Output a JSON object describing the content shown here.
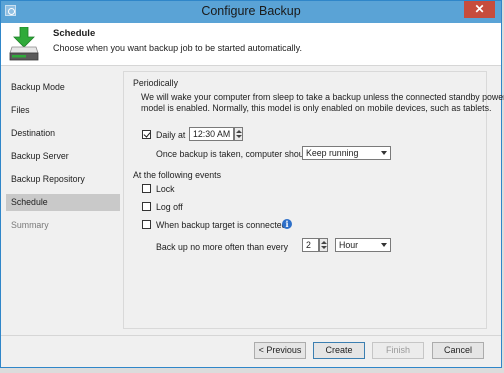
{
  "window": {
    "title": "Configure Backup",
    "close_glyph": "✕"
  },
  "header": {
    "title": "Schedule",
    "subtitle": "Choose when you want backup job to be started automatically.",
    "icon": "download-drive-icon"
  },
  "sidebar": {
    "items": [
      {
        "label": "Backup Mode",
        "state": "normal"
      },
      {
        "label": "Files",
        "state": "normal"
      },
      {
        "label": "Destination",
        "state": "normal"
      },
      {
        "label": "Backup Server",
        "state": "normal"
      },
      {
        "label": "Backup Repository",
        "state": "normal"
      },
      {
        "label": "Schedule",
        "state": "active"
      },
      {
        "label": "Summary",
        "state": "disabled"
      }
    ]
  },
  "periodically": {
    "label": "Periodically",
    "description_line1": "We will wake your computer from sleep to take a backup unless the connected standby power",
    "description_line2": "model is enabled. Normally, this model is only enabled on mobile devices, such as tablets.",
    "daily": {
      "label": "Daily at",
      "checked": true,
      "time": "12:30 AM"
    },
    "after_backup": {
      "label": "Once backup is taken, computer should",
      "value": "Keep running"
    }
  },
  "events": {
    "label": "At the following events",
    "lock": {
      "label": "Lock",
      "checked": false
    },
    "logoff": {
      "label": "Log off",
      "checked": false
    },
    "target_connected": {
      "label": "When backup target is connected",
      "checked": false
    },
    "info_glyph": "i",
    "frequency": {
      "label": "Back up no more often than every",
      "number": "2",
      "unit": "Hour"
    }
  },
  "buttons": {
    "previous": "< Previous",
    "create": "Create",
    "finish": "Finish",
    "cancel": "Cancel"
  },
  "colors": {
    "titlebar": "#5aa3d6",
    "window_border": "#2f86c9",
    "close_button": "#c74c3c",
    "active_nav": "#c9c9c9"
  }
}
